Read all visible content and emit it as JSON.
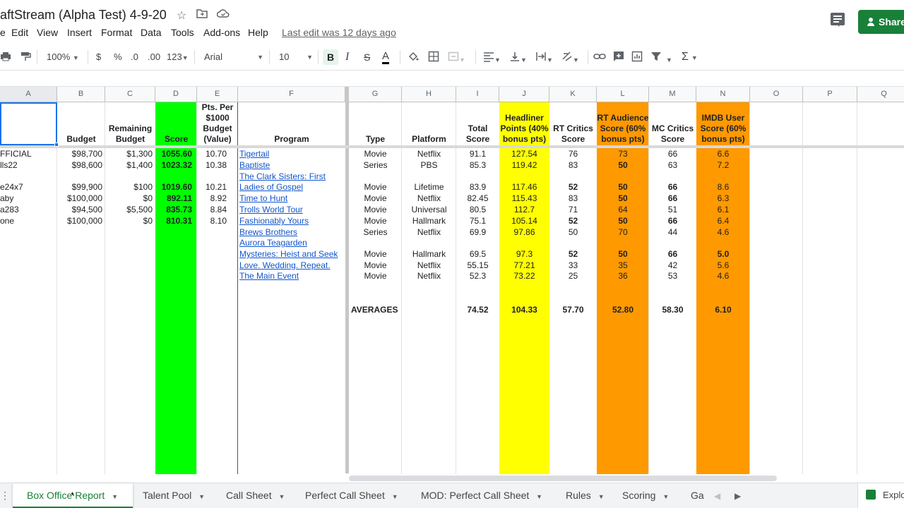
{
  "title": "aftStream (Alpha Test)  4-9-20",
  "menu": [
    "e",
    "Edit",
    "View",
    "Insert",
    "Format",
    "Data",
    "Tools",
    "Add-ons",
    "Help"
  ],
  "last_edit": "Last edit was 12 days ago",
  "share_label": "Share",
  "toolbar": {
    "zoom": "100%",
    "currency": "$",
    "percent": "%",
    "dec_decrease": ".0",
    "dec_increase": ".00",
    "format": "123",
    "font": "Arial",
    "font_size": "10",
    "bold": "B",
    "italic": "I",
    "strike": "S",
    "text_color": "A",
    "functions": "Σ"
  },
  "columns": [
    "A",
    "B",
    "C",
    "D",
    "E",
    "F",
    "G",
    "H",
    "I",
    "J",
    "K",
    "L",
    "M",
    "N",
    "O",
    "P",
    "Q"
  ],
  "headers": {
    "B": "Budget",
    "C": "Remaining Budget",
    "D": "Score",
    "E": "Pts. Per $1000 Budget (Value)",
    "F": "Program",
    "G": "Type",
    "H": "Platform",
    "I": "Total Score",
    "J": "Headliner Points (40% bonus pts)",
    "K": "RT Critics Score",
    "L": "RT Audience Score (60% bonus pts)",
    "M": "MC Critics Score",
    "N": "IMDB User Score (60% bonus pts)"
  },
  "left_rows": [
    {
      "a": "FFICIAL",
      "b": "$98,700",
      "c": "$1,300",
      "d": "1055.60",
      "e": "10.70"
    },
    {
      "a": "lls22",
      "b": "$98,600",
      "c": "$1,400",
      "d": "1023.32",
      "e": "10.38"
    },
    {
      "a": "e24x7",
      "b": "$99,900",
      "c": "$100",
      "d": "1019.60",
      "e": "10.21"
    },
    {
      "a": "aby",
      "b": "$100,000",
      "c": "$0",
      "d": "892.11",
      "e": "8.92"
    },
    {
      "a": "a283",
      "b": "$94,500",
      "c": "$5,500",
      "d": "835.73",
      "e": "8.84"
    },
    {
      "a": "one",
      "b": "$100,000",
      "c": "$0",
      "d": "810.31",
      "e": "8.10"
    }
  ],
  "programs": [
    {
      "line1": "Tigertail",
      "line2": "",
      "type": "Movie",
      "platform": "Netflix",
      "total": "91.1",
      "headliner": "127.54",
      "rt_critics": "76",
      "rt_audience": "73",
      "mc": "66",
      "imdb": "6.6"
    },
    {
      "line1": "Baptiste",
      "line2": "",
      "type": "Series",
      "platform": "PBS",
      "total": "85.3",
      "headliner": "119.42",
      "rt_critics": "83",
      "rt_audience": "50",
      "mc": "63",
      "imdb": "7.2"
    },
    {
      "line1": "The Clark Sisters: First",
      "line2": "Ladies of Gospel",
      "type": "Movie",
      "platform": "Lifetime",
      "total": "83.9",
      "headliner": "117.46",
      "rt_critics": "52",
      "rt_audience": "50",
      "mc": "66",
      "imdb": "8.6"
    },
    {
      "line1": "Time to Hunt",
      "line2": "",
      "type": "Movie",
      "platform": "Netflix",
      "total": "82.45",
      "headliner": "115.43",
      "rt_critics": "83",
      "rt_audience": "50",
      "mc": "66",
      "imdb": "6.3"
    },
    {
      "line1": "Trolls World Tour",
      "line2": "",
      "type": "Movie",
      "platform": "Universal",
      "total": "80.5",
      "headliner": "112.7",
      "rt_critics": "71",
      "rt_audience": "64",
      "mc": "51",
      "imdb": "6.1"
    },
    {
      "line1": "Fashionably Yours",
      "line2": "",
      "type": "Movie",
      "platform": "Hallmark",
      "total": "75.1",
      "headliner": "105.14",
      "rt_critics": "52",
      "rt_audience": "50",
      "mc": "66",
      "imdb": "6.4"
    },
    {
      "line1": "Brews Brothers",
      "line2": "",
      "type": "Series",
      "platform": "Netflix",
      "total": "69.9",
      "headliner": "97.86",
      "rt_critics": "50",
      "rt_audience": "70",
      "mc": "44",
      "imdb": "4.6"
    },
    {
      "line1": "Aurora Teagarden",
      "line2": "Mysteries: Heist and Seek",
      "type": "Movie",
      "platform": "Hallmark",
      "total": "69.5",
      "headliner": "97.3",
      "rt_critics": "52",
      "rt_audience": "50",
      "mc": "66",
      "imdb": "5.0"
    },
    {
      "line1": "Love. Wedding. Repeat.",
      "line2": "",
      "type": "Movie",
      "platform": "Netflix",
      "total": "55.15",
      "headliner": "77.21",
      "rt_critics": "33",
      "rt_audience": "35",
      "mc": "42",
      "imdb": "5.6"
    },
    {
      "line1": "The Main Event",
      "line2": "",
      "type": "Movie",
      "platform": "Netflix",
      "total": "52.3",
      "headliner": "73.22",
      "rt_critics": "25",
      "rt_audience": "36",
      "mc": "53",
      "imdb": "4.6"
    }
  ],
  "averages": {
    "label": "AVERAGES",
    "total": "74.52",
    "headliner": "104.33",
    "rt_critics": "57.70",
    "rt_audience": "52.80",
    "mc": "58.30",
    "imdb": "6.10"
  },
  "sheet_tabs": [
    "Box Office Report",
    "Talent Pool",
    "Call Sheet",
    "Perfect Call Sheet",
    "MOD: Perfect Call Sheet",
    "Rules",
    "Scoring",
    "Ga"
  ],
  "active_tab": "Box Office Report",
  "explore_label": "Explo",
  "colors": {
    "green_fill": "#00ff00",
    "yellow_fill": "#ffff00",
    "orange_fill": "#ff9900",
    "share_green": "#188038",
    "link_blue": "#1155cc"
  }
}
